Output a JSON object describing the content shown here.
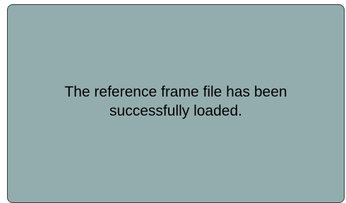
{
  "dialog": {
    "message": "The reference frame file has been successfully loaded."
  },
  "colors": {
    "panel_background": "#93adaf",
    "panel_border": "#2f3a3b",
    "text": "#000000"
  }
}
